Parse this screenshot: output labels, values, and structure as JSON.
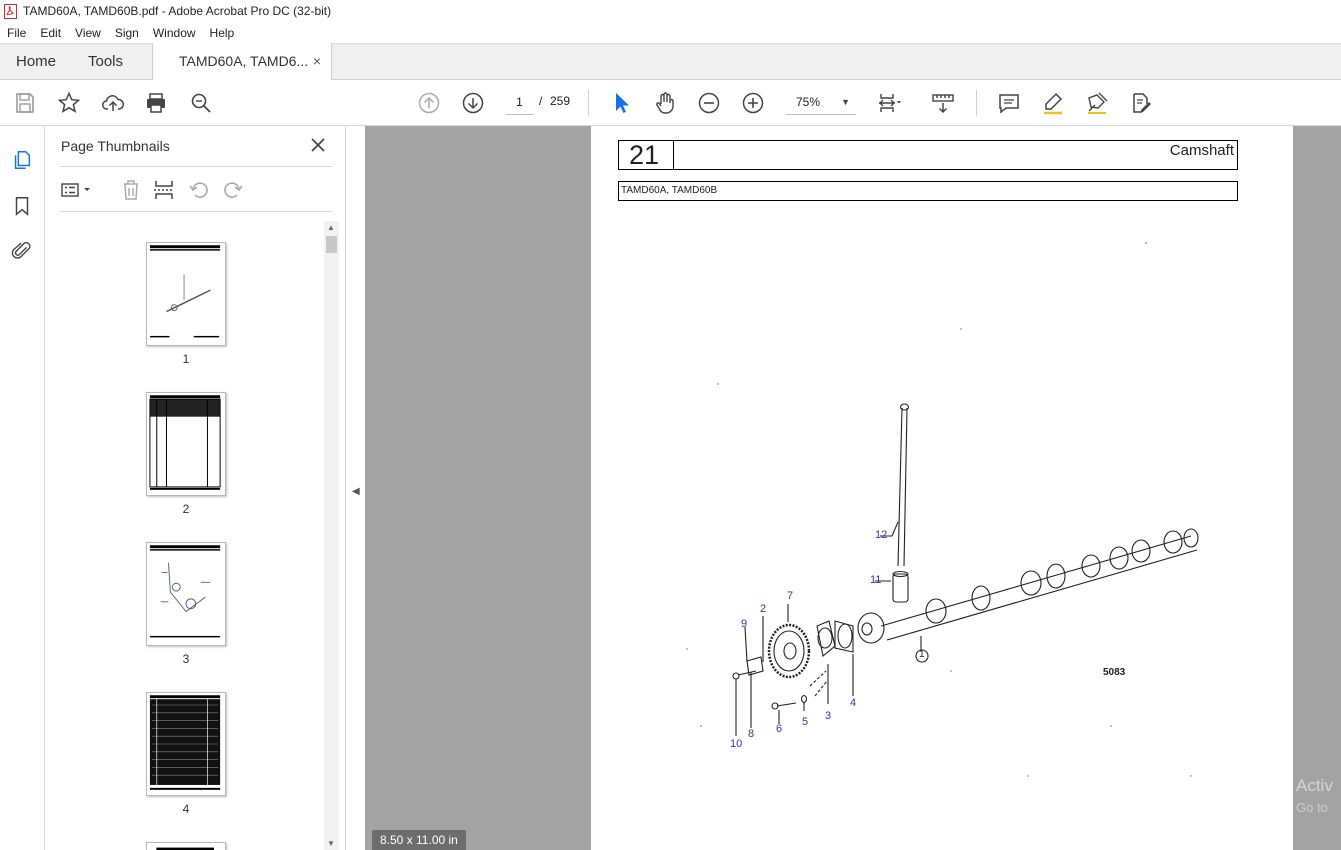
{
  "window": {
    "title": "TAMD60A, TAMD60B.pdf - Adobe Acrobat Pro DC (32-bit)"
  },
  "menu": [
    "File",
    "Edit",
    "View",
    "Sign",
    "Window",
    "Help"
  ],
  "tabs": {
    "home": "Home",
    "tools": "Tools",
    "document": "TAMD60A, TAMD6...",
    "close": "×"
  },
  "nav": {
    "page_current": "1",
    "separator": "/",
    "page_total": "259"
  },
  "zoom": {
    "value": "75%"
  },
  "thumbnails_panel": {
    "title": "Page Thumbnails",
    "pages": [
      "1",
      "2",
      "3",
      "4"
    ]
  },
  "document": {
    "section_number": "21",
    "section_title": "Camshaft",
    "models": "TAMD60A, TAMD60B",
    "figure_code": "5083",
    "callouts": [
      "12",
      "11",
      "7",
      "2",
      "9",
      "1",
      "4",
      "3",
      "5",
      "6",
      "8",
      "10"
    ]
  },
  "status": {
    "page_size": "8.50 x 11.00 in"
  },
  "watermark": {
    "line1": "Activ",
    "line2": "Go to"
  },
  "colors": {
    "accent": "#1473e6",
    "callout": "#2c3aa0",
    "pdf_red": "#d7282f"
  }
}
